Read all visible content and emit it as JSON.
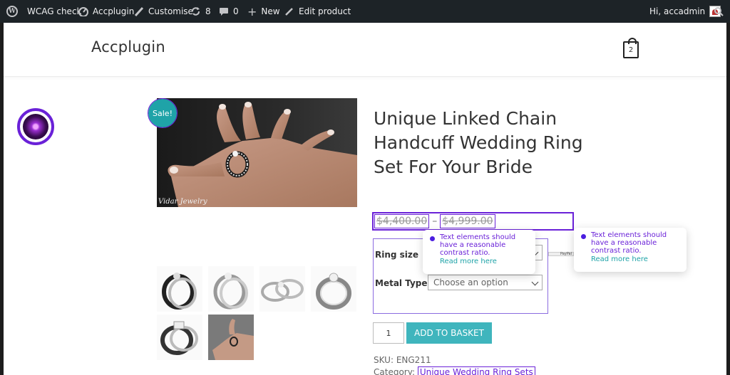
{
  "admin_bar": {
    "site": "WCAG check",
    "dashboard": "Accplugin",
    "customise": "Customise",
    "updates_count": "8",
    "comments_count": "0",
    "new": "New",
    "edit": "Edit product",
    "greeting": "Hi, accadmin"
  },
  "header": {
    "site_title": "Accplugin",
    "cart_count": "2"
  },
  "product": {
    "sale_badge": "Sale!",
    "image_caption": "Vidar Jewelry",
    "title": "Unique Linked Chain Handcuff Wedding Ring Set For Your Bride",
    "price_low": "$4,400.00",
    "price_sep": "–",
    "price_high": "$4,999.00",
    "variations": [
      {
        "label": "Ring size",
        "value": ""
      },
      {
        "label": "Metal Type",
        "value": "Choose an option"
      }
    ],
    "quantity": "1",
    "add_to_basket": "ADD TO BASKET",
    "sku_label": "SKU:",
    "sku_value": "ENG211",
    "category_label": "Category:",
    "category_value": "Unique Wedding Ring Sets"
  },
  "tooltips": [
    {
      "message": "Text elements should have a reasonable contrast ratio.",
      "link": "Read more here"
    },
    {
      "message": "Text elements should have a reasonable contrast ratio.",
      "link": "Read more here"
    }
  ],
  "paypal_label": "PayPal",
  "colors": {
    "accent_purple": "#6a21d8",
    "teal": "#3fb5bd",
    "admin_bar": "#1d2327"
  }
}
